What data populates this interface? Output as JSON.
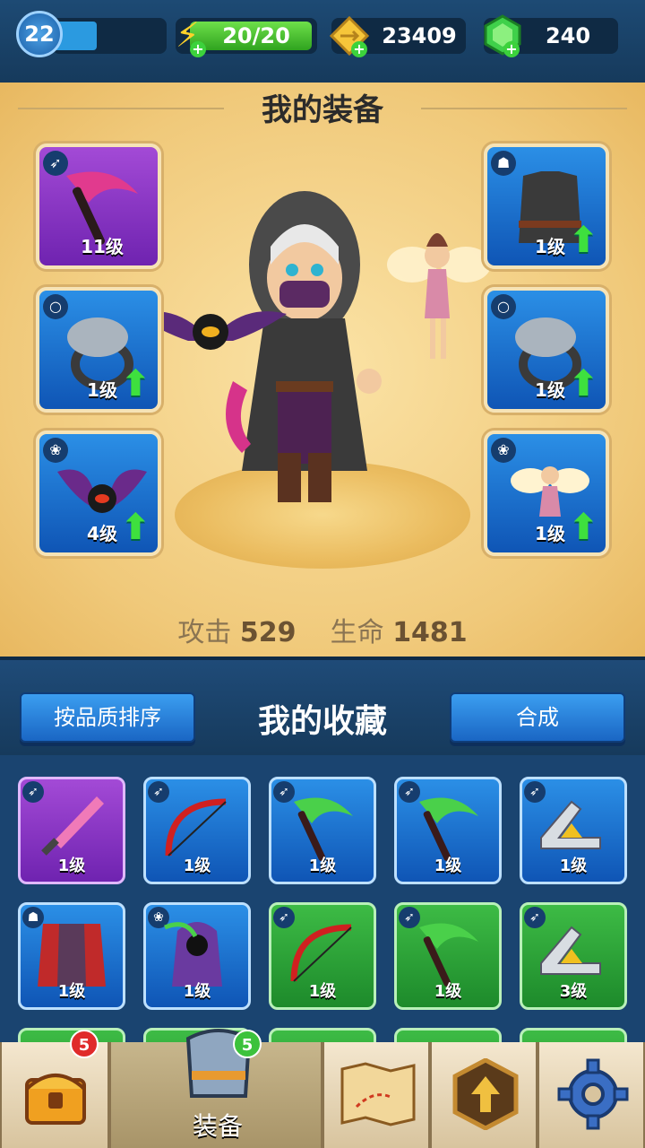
{
  "status": {
    "level": "22",
    "xp_fraction": 0.4,
    "energy": "20/20",
    "gold": "23409",
    "gems": "240"
  },
  "equipment": {
    "title": "我的装备",
    "slots": [
      {
        "name": "weapon",
        "level": "11级",
        "rarity": "purple",
        "type_icon": "bow-icon",
        "item_icon": "scythe-icon",
        "upgrade": false
      },
      {
        "name": "armor",
        "level": "1级",
        "rarity": "blue",
        "type_icon": "armor-icon",
        "item_icon": "dark-vest-icon",
        "upgrade": true
      },
      {
        "name": "ring-1",
        "level": "1级",
        "rarity": "blue",
        "type_icon": "ring-icon",
        "item_icon": "serpent-ring-icon",
        "upgrade": true
      },
      {
        "name": "ring-2",
        "level": "1级",
        "rarity": "blue",
        "type_icon": "ring-icon",
        "item_icon": "serpent-ring-icon",
        "upgrade": true
      },
      {
        "name": "pet-1",
        "level": "4级",
        "rarity": "blue",
        "type_icon": "paw-icon",
        "item_icon": "bat-eye-icon",
        "upgrade": true
      },
      {
        "name": "pet-2",
        "level": "1级",
        "rarity": "blue",
        "type_icon": "paw-icon",
        "item_icon": "fairy-icon",
        "upgrade": true
      }
    ],
    "attack_label": "攻击",
    "attack_value": "529",
    "hp_label": "生命",
    "hp_value": "1481"
  },
  "collection": {
    "sort_button": "按品质排序",
    "title": "我的收藏",
    "fuse_button": "合成",
    "items": [
      {
        "level": "1级",
        "rarity": "purple",
        "type_icon": "bow-icon",
        "item_icon": "pink-sword-icon"
      },
      {
        "level": "1级",
        "rarity": "blue",
        "type_icon": "bow-icon",
        "item_icon": "red-bow-icon"
      },
      {
        "level": "1级",
        "rarity": "blue",
        "type_icon": "bow-icon",
        "item_icon": "green-scythe-icon"
      },
      {
        "level": "1级",
        "rarity": "blue",
        "type_icon": "bow-icon",
        "item_icon": "green-scythe-icon"
      },
      {
        "level": "1级",
        "rarity": "blue",
        "type_icon": "bow-icon",
        "item_icon": "boomerang-icon"
      },
      {
        "level": "1级",
        "rarity": "blue",
        "type_icon": "armor-icon",
        "item_icon": "red-cape-icon"
      },
      {
        "level": "1级",
        "rarity": "blue",
        "type_icon": "paw-icon",
        "item_icon": "reaper-pet-icon"
      },
      {
        "level": "1级",
        "rarity": "green",
        "type_icon": "bow-icon",
        "item_icon": "red-bow-icon"
      },
      {
        "level": "1级",
        "rarity": "green",
        "type_icon": "bow-icon",
        "item_icon": "green-scythe-icon"
      },
      {
        "level": "3级",
        "rarity": "green",
        "type_icon": "bow-icon",
        "item_icon": "boomerang-icon"
      }
    ]
  },
  "nav": {
    "chest_badge": "5",
    "equip_label": "装备",
    "equip_badge": "5",
    "items": [
      "chest-icon",
      "armor-icon",
      "map-icon",
      "upgrade-icon",
      "gear-icon"
    ]
  },
  "colors": {
    "purple": "#8a35c6",
    "blue": "#1f73d0",
    "green": "#2aa23a",
    "panel": "#f0c97a"
  }
}
